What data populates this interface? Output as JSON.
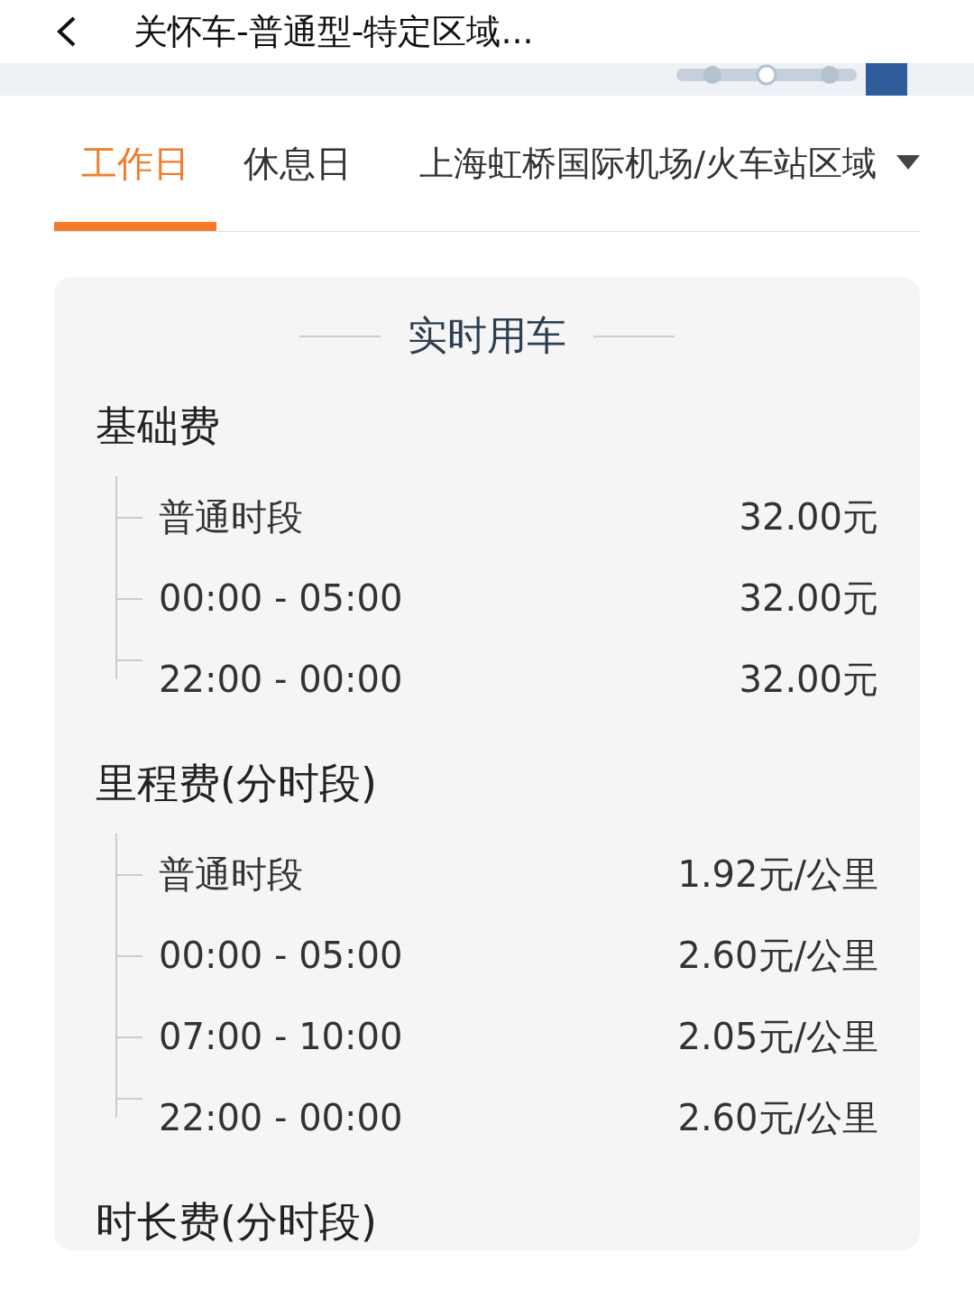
{
  "header": {
    "title": "关怀车-普通型-特定区域..."
  },
  "tabs": [
    {
      "label": "工作日",
      "selected": true
    },
    {
      "label": "休息日",
      "selected": false
    }
  ],
  "area_dropdown": {
    "value": "上海虹桥国际机场/火车站区域"
  },
  "card": {
    "title": "实时用车",
    "sections": [
      {
        "heading": "基础费",
        "rows": [
          {
            "label": "普通时段",
            "price": "32.00元"
          },
          {
            "label": "00:00 - 05:00",
            "price": "32.00元"
          },
          {
            "label": "22:00 - 00:00",
            "price": "32.00元"
          }
        ]
      },
      {
        "heading": "里程费(分时段)",
        "rows": [
          {
            "label": "普通时段",
            "price": "1.92元/公里"
          },
          {
            "label": "00:00 - 05:00",
            "price": "2.60元/公里"
          },
          {
            "label": "07:00 - 10:00",
            "price": "2.05元/公里"
          },
          {
            "label": "22:00 - 00:00",
            "price": "2.60元/公里"
          }
        ]
      },
      {
        "heading": "时长费(分时段)"
      }
    ]
  }
}
